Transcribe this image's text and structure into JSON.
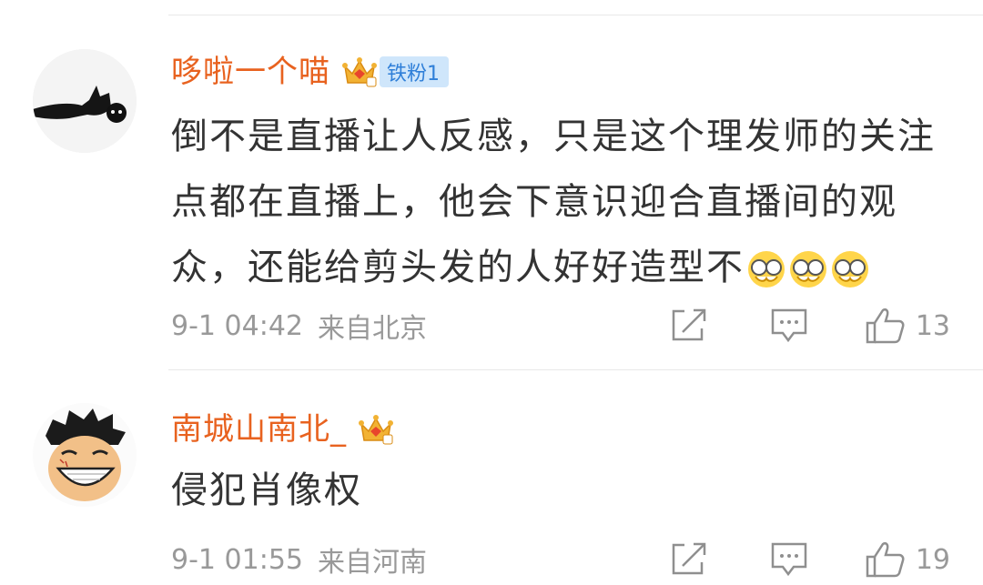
{
  "comments": [
    {
      "username": "哆啦一个喵",
      "badge": "铁粉1",
      "text": "倒不是直播让人反感，只是这个理发师的关注点都在直播上，他会下意识迎合直播间的观众，还能给剪头发的人好好造型不",
      "emoji_icons": [
        "glasses-cry-emoji",
        "glasses-cry-emoji",
        "glasses-cry-emoji"
      ],
      "timestamp": "9-1 04:42",
      "location": "来自北京",
      "likes": "13"
    },
    {
      "username": "南城山南北_",
      "badge": "",
      "text": "侵犯肖像权",
      "timestamp": "9-1 01:55",
      "location": "来自河南",
      "likes": "19"
    }
  ],
  "icons": {
    "share": "share-icon",
    "comment": "comment-icon",
    "like": "thumbs-up-icon",
    "crown": "crown-badge-icon"
  },
  "colors": {
    "username": "#e8621f",
    "text": "#333333",
    "meta": "#999999",
    "badge_bg": "#cfe6fb",
    "badge_text": "#2f7fd8"
  }
}
